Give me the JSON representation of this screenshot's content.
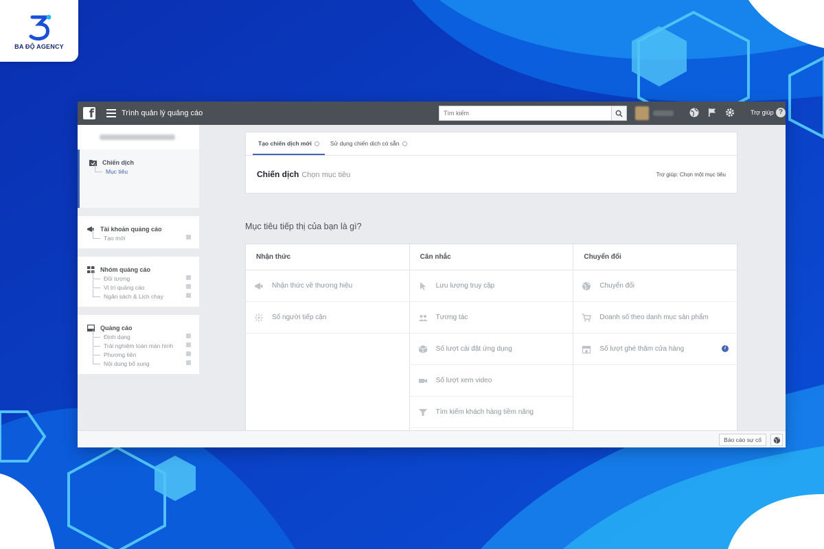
{
  "brand": {
    "logo_text": "BA ĐỘ AGENCY"
  },
  "topbar": {
    "title": "Trình quản lý quảng cáo",
    "search_placeholder": "Tìm kiếm",
    "help_label": "Trợ giúp",
    "help_icon": "?"
  },
  "sidebar": {
    "sections": [
      {
        "title": "Chiến dịch",
        "items": [
          "Mục tiêu"
        ]
      },
      {
        "title": "Tài khoản quảng cáo",
        "items": [
          "Tạo mới"
        ]
      },
      {
        "title": "Nhóm quảng cáo",
        "items": [
          "Đối tượng",
          "Vị trí quảng cáo",
          "Ngân sách & Lịch chạy"
        ]
      },
      {
        "title": "Quảng cáo",
        "items": [
          "Định dạng",
          "Trải nghiệm toàn màn hình",
          "Phương tiện",
          "Nội dung bổ sung"
        ]
      }
    ]
  },
  "tabs": [
    {
      "label": "Tạo chiến dịch mới"
    },
    {
      "label": "Sử dụng chiến dịch có sẵn"
    }
  ],
  "campaign": {
    "label": "Chiến dịch",
    "step": "Chọn mục tiêu",
    "help": "Trợ giúp: Chọn một mục tiêu"
  },
  "question": "Mục tiêu tiếp thị của bạn là gì?",
  "objectives": {
    "columns": [
      {
        "title": "Nhận thức",
        "items": [
          "Nhận thức về thương hiệu",
          "Số người tiếp cận"
        ]
      },
      {
        "title": "Cân nhắc",
        "items": [
          "Lưu lượng truy cập",
          "Tương tác",
          "Số lượt cài đặt ứng dụng",
          "Số lượt xem video",
          "Tìm kiếm khách hàng tiềm năng"
        ]
      },
      {
        "title": "Chuyển đổi",
        "items": [
          "Chuyển đổi",
          "Doanh số theo danh mục sản phẩm",
          "Số lượt ghé thăm cửa hàng"
        ]
      }
    ]
  },
  "footer": {
    "report_label": "Báo cáo sự cố"
  },
  "colors": {
    "accent": "#4267b2",
    "topbar": "#4b4f56",
    "background": "#0a3fc4"
  }
}
